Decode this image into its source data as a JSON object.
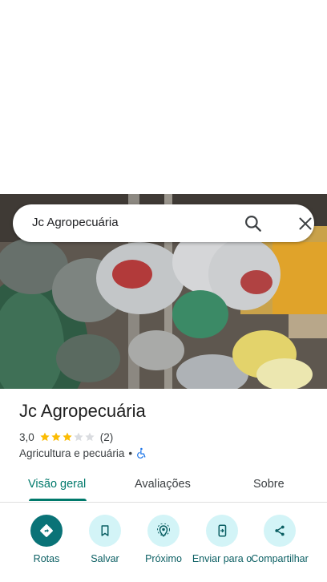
{
  "search": {
    "query": "Jc Agropecuária",
    "search_icon": "search-icon",
    "close_icon": "close-icon"
  },
  "place": {
    "name": "Jc Agropecuária",
    "rating": "3,0",
    "rating_stars": 3,
    "rating_max": 5,
    "review_count": "(2)",
    "category": "Agricultura e pecuária",
    "separator": "•",
    "accessibility_icon": "wheelchair-icon"
  },
  "tabs": [
    {
      "label": "Visão geral",
      "active": true
    },
    {
      "label": "Avaliações",
      "active": false
    },
    {
      "label": "Sobre",
      "active": false
    }
  ],
  "actions": [
    {
      "label": "Rotas",
      "icon": "directions-icon"
    },
    {
      "label": "Salvar",
      "icon": "bookmark-icon"
    },
    {
      "label": "Próximo",
      "icon": "nearby-icon"
    },
    {
      "label": "Enviar para o",
      "icon": "send-to-phone-icon"
    },
    {
      "label": "Compartilhar",
      "icon": "share-icon"
    }
  ],
  "colors": {
    "accent": "#00796b",
    "action_bg": "#d3f4f7",
    "action_primary": "#0a7377",
    "star_filled": "#fbbc04",
    "star_empty": "#dadce0",
    "accessibility": "#1a73e8"
  }
}
